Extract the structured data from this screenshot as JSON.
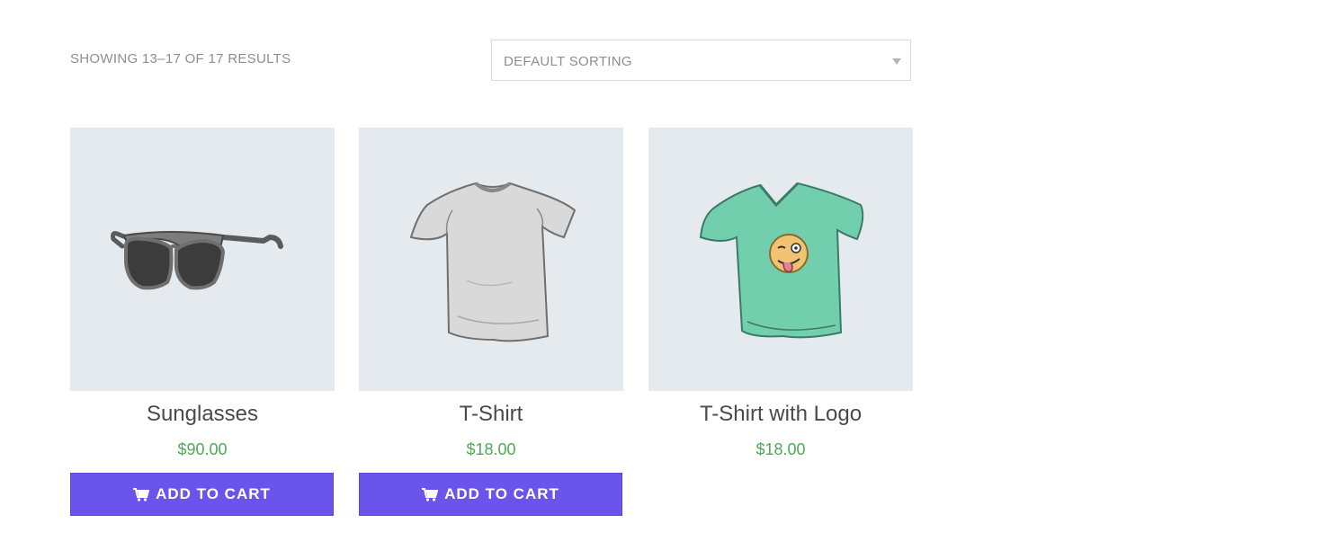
{
  "shop": {
    "result_count": "SHOWING 13–17 OF 17 RESULTS",
    "sorting": {
      "selected": "DEFAULT SORTING"
    }
  },
  "products": [
    {
      "title": "Sunglasses",
      "price": "$90.00",
      "button_label": "ADD TO CART",
      "image_icon": "sunglasses-image"
    },
    {
      "title": "T-Shirt",
      "price": "$18.00",
      "button_label": "ADD TO CART",
      "image_icon": "tshirt-image"
    },
    {
      "title": "T-Shirt with Logo",
      "price": "$18.00",
      "image_icon": "tshirt-with-logo-image"
    }
  ],
  "colors": {
    "accent": "#6b54ec",
    "price": "#4daa57",
    "image_bg": "#e5eaef",
    "title": "#4a4a4a",
    "muted": "#8e8e8e"
  }
}
